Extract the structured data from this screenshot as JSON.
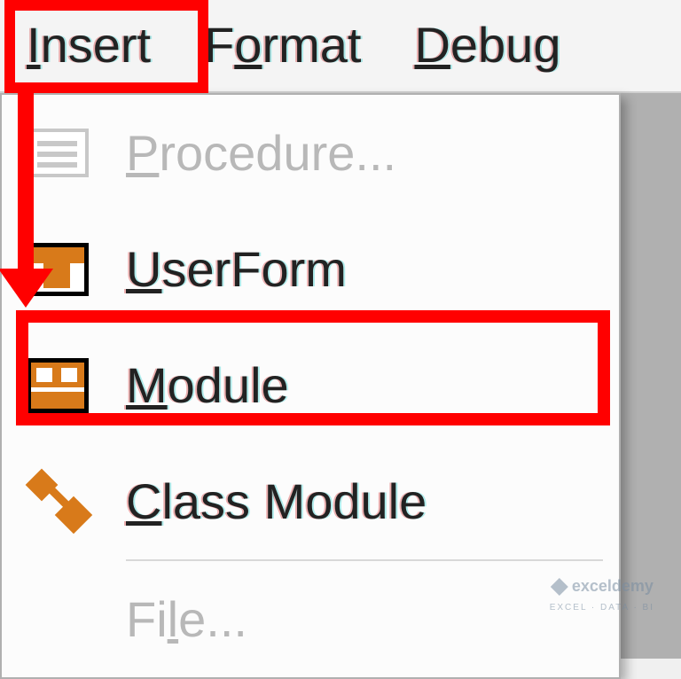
{
  "menubar": {
    "insert": "Insert",
    "format": "Format",
    "debug": "Debug"
  },
  "dropdown": {
    "procedure": "Procedure...",
    "userform": "UserForm",
    "module": "Module",
    "classmodule": "Class Module",
    "file": "File..."
  },
  "watermark": {
    "main": "exceldemy",
    "sub": "EXCEL · DATA · BI"
  }
}
